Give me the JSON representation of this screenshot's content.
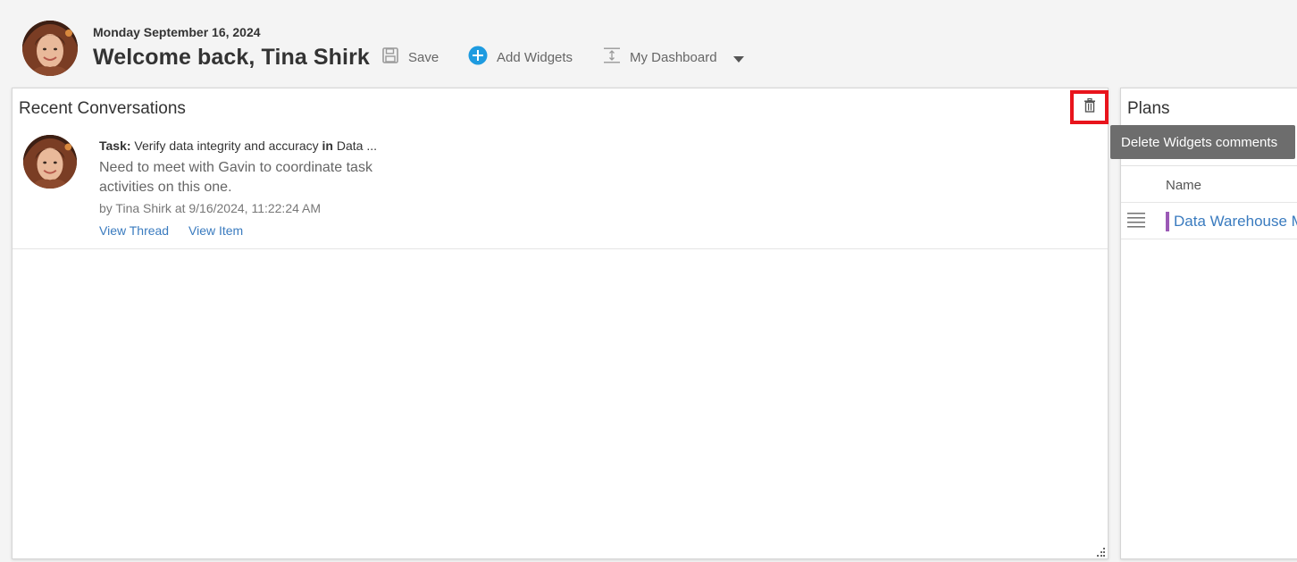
{
  "header": {
    "date": "Monday September 16, 2024",
    "welcome": "Welcome back, Tina Shirk",
    "toolbar": {
      "save_label": "Save",
      "add_widgets_label": "Add Widgets",
      "dashboard_label": "My Dashboard"
    }
  },
  "conversations": {
    "title": "Recent Conversations",
    "item": {
      "task_prefix": "Task:",
      "task_name": " Verify data integrity and accuracy ",
      "in_word": "in",
      "project": " Data ...",
      "message": "Need to meet with Gavin to coordinate task activities on this one.",
      "byline": "by Tina Shirk at 9/16/2024, 11:22:24 AM",
      "view_thread": "View Thread",
      "view_item": "View Item"
    }
  },
  "plans": {
    "title": "Plans",
    "column_name": "Name",
    "rows": [
      {
        "name": "Data Warehouse M",
        "color": "#9b59b6"
      }
    ]
  },
  "tooltip": {
    "text": "Delete Widgets comments"
  },
  "colors": {
    "accent_blue": "#1e9be0",
    "link_blue": "#3a7bbf",
    "highlight_red": "#e8141c",
    "tooltip_bg": "#6d6d6d"
  },
  "icons": {
    "save": "floppy-disk-icon",
    "add": "plus-circle-icon",
    "dashboard": "dashboard-layout-icon",
    "dropdown": "caret-down-icon",
    "delete": "trash-icon",
    "drag": "hamburger-drag-icon",
    "resize": "resize-grip-icon"
  }
}
